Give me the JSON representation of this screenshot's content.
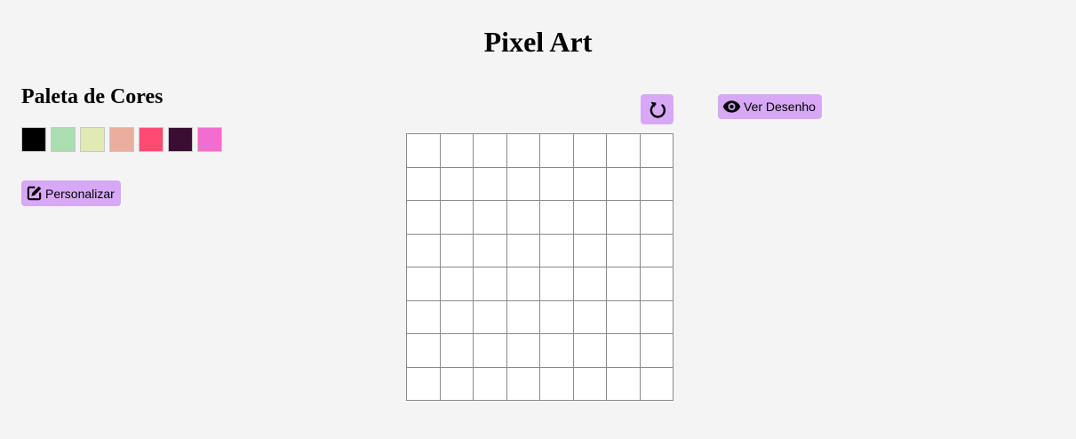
{
  "page": {
    "title": "Pixel Art"
  },
  "palette": {
    "heading": "Paleta de Cores",
    "colors": [
      "#000000",
      "#abdeb0",
      "#e1e9b5",
      "#ebae9e",
      "#ff4b72",
      "#3b0d32",
      "#f06ecf"
    ]
  },
  "buttons": {
    "customize_label": "Personalizar",
    "customize_icon": "edit-icon",
    "view_label": "Ver Desenho",
    "view_icon": "eye-icon",
    "reset_icon": "reset-icon"
  },
  "canvas": {
    "rows": 8,
    "cols": 8,
    "cell_color": "#ffffff"
  },
  "colors": {
    "background": "#f4f4f4",
    "button": "#d7a8f5"
  }
}
